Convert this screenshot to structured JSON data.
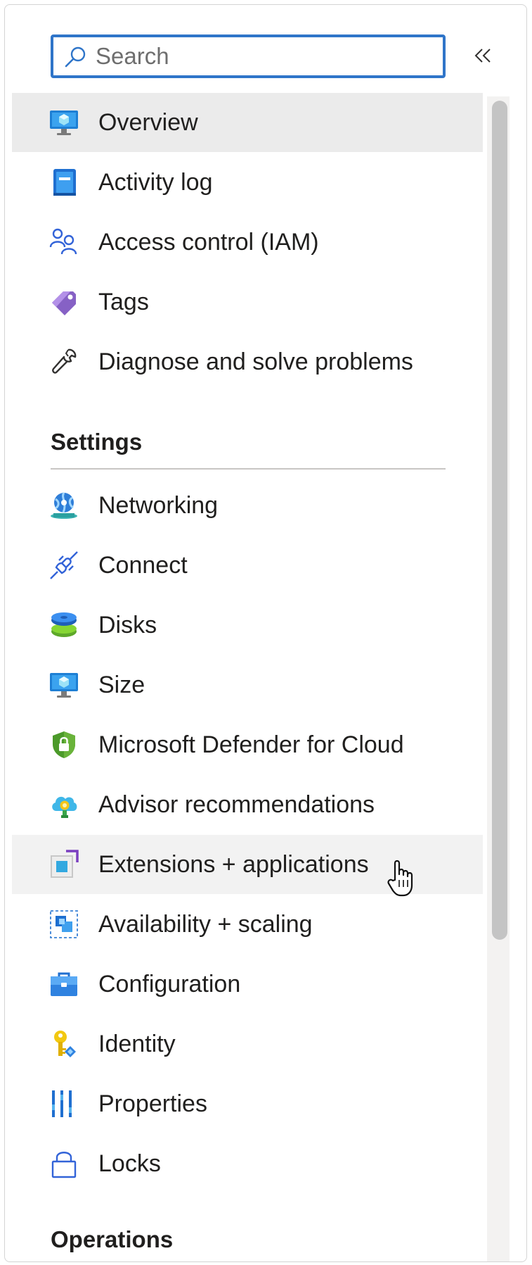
{
  "search": {
    "placeholder": "Search",
    "value": ""
  },
  "collapse": {
    "icon": "double-chevron-left-icon",
    "glyph": "«"
  },
  "nav": {
    "top_items": [
      {
        "label": "Overview",
        "icon": "vm-monitor-icon",
        "state": "selected"
      },
      {
        "label": "Activity log",
        "icon": "activity-log-icon"
      },
      {
        "label": "Access control (IAM)",
        "icon": "users-icon"
      },
      {
        "label": "Tags",
        "icon": "tag-icon"
      },
      {
        "label": "Diagnose and solve problems",
        "icon": "wrench-icon"
      }
    ],
    "settings": {
      "header": "Settings",
      "items": [
        {
          "label": "Networking",
          "icon": "network-globe-icon"
        },
        {
          "label": "Connect",
          "icon": "plug-icon"
        },
        {
          "label": "Disks",
          "icon": "disks-icon"
        },
        {
          "label": "Size",
          "icon": "vm-monitor-icon"
        },
        {
          "label": "Microsoft Defender for Cloud",
          "icon": "shield-lock-icon"
        },
        {
          "label": "Advisor recommendations",
          "icon": "advisor-cloud-icon"
        },
        {
          "label": "Extensions + applications",
          "icon": "extensions-icon",
          "state": "hover"
        },
        {
          "label": "Availability + scaling",
          "icon": "availability-icon"
        },
        {
          "label": "Configuration",
          "icon": "briefcase-icon"
        },
        {
          "label": "Identity",
          "icon": "key-icon"
        },
        {
          "label": "Properties",
          "icon": "properties-bars-icon"
        },
        {
          "label": "Locks",
          "icon": "lock-icon"
        }
      ]
    },
    "operations": {
      "header": "Operations"
    }
  },
  "colors": {
    "accent": "#2f75c9",
    "selected_bg": "#ebebeb",
    "hover_bg": "#f2f2f2"
  }
}
